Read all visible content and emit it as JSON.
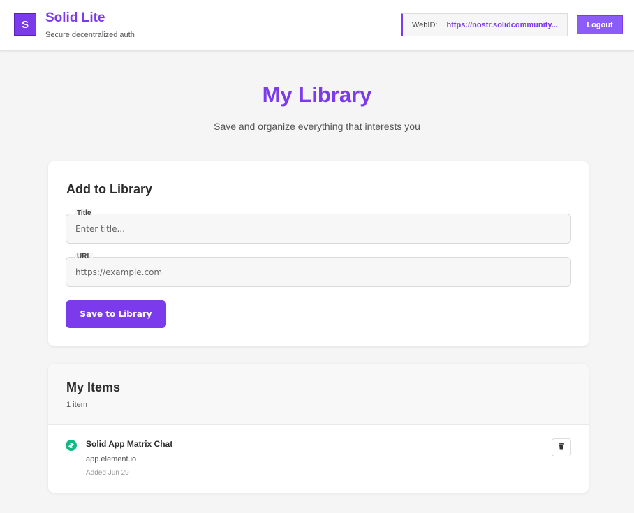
{
  "header": {
    "logo_letter": "S",
    "app_title": "Solid Lite",
    "app_subtitle": "Secure decentralized auth",
    "webid_label": "WebID:",
    "webid_value": "https://nostr.solidcommunity...",
    "logout_label": "Logout"
  },
  "hero": {
    "title": "My Library",
    "subtitle": "Save and organize everything that interests you"
  },
  "add_form": {
    "heading": "Add to Library",
    "title_label": "Title",
    "title_placeholder": "Enter title...",
    "title_value": "",
    "url_label": "URL",
    "url_placeholder": "https://example.com",
    "url_value": "",
    "save_label": "Save to Library"
  },
  "items": {
    "heading": "My Items",
    "count_text": "1 item",
    "list": [
      {
        "title": "Solid App Matrix Chat",
        "domain": "app.element.io",
        "added": "Added Jun 29",
        "icon": "link-icon"
      }
    ]
  },
  "colors": {
    "accent": "#7c3aed",
    "item_icon": "#10b981",
    "background": "#f5f5f5"
  }
}
